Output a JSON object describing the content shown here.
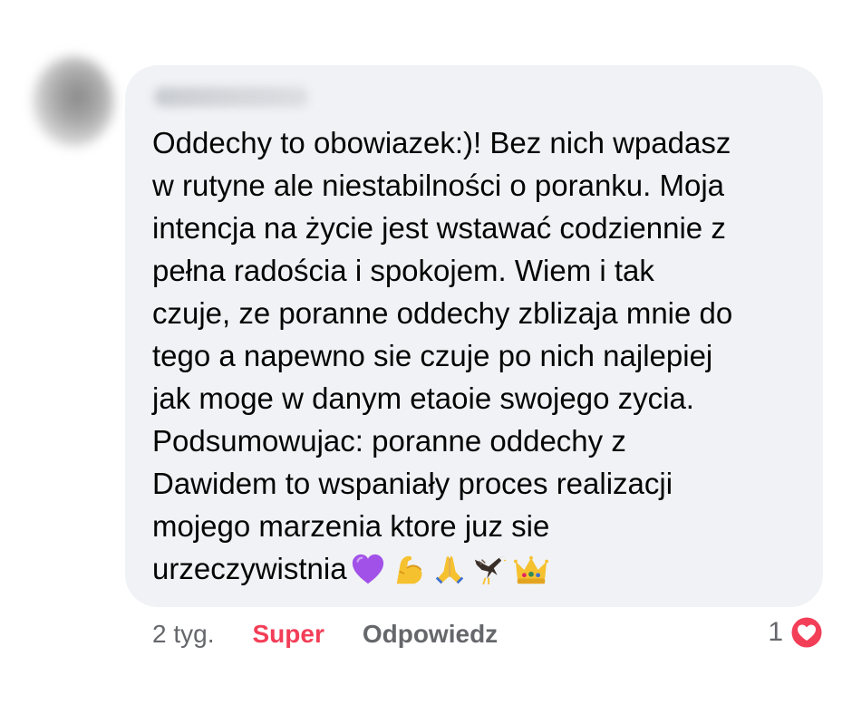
{
  "comment": {
    "lines": [
      "Oddechy to obowiazek:)! Bez nich wpadasz",
      "w rutyne ale niestabilności o poranku. Moja",
      "intencja na życie jest wstawać codziennie z",
      "pełna radościa i spokojem. Wiem i tak",
      "czuje, ze poranne oddechy zblizaja mnie do",
      "tego a napewno sie czuje po nich najlepiej",
      "jak moge w danym etaoie swojego zycia.",
      "Podsumowujac: poranne oddechy z",
      "Dawidem to wspaniały proces realizacji",
      "mojego marzenia ktore juz sie",
      "urzeczywistnia"
    ],
    "emojis": [
      "purple-heart",
      "flexed-biceps",
      "folded-hands",
      "eagle",
      "crown"
    ]
  },
  "actions": {
    "time": "2 tyg.",
    "reaction": "Super",
    "reply": "Odpowiedz"
  },
  "reactions": {
    "count": "1",
    "icon": "heart-icon",
    "color": "#f33e58"
  }
}
